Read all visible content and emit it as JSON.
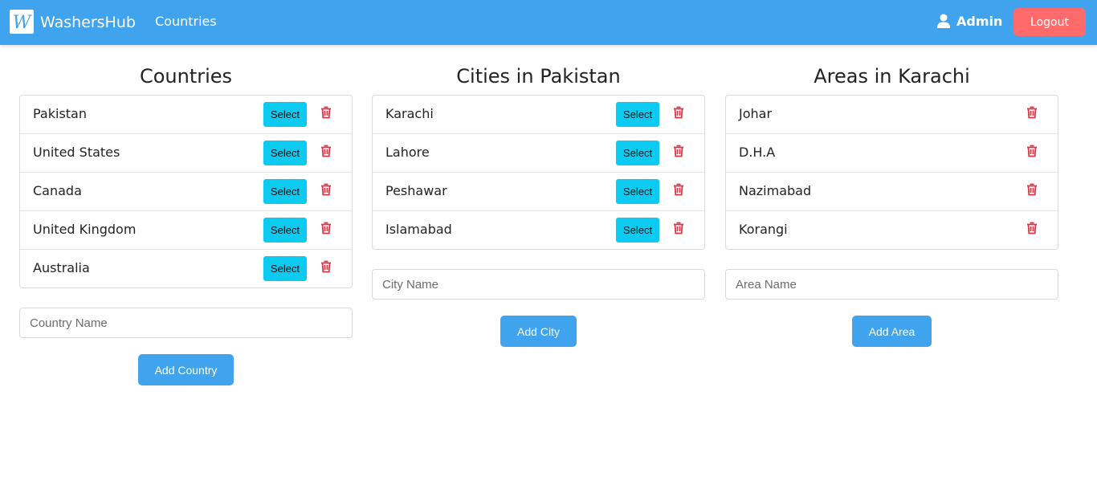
{
  "navbar": {
    "brand": "WashersHub",
    "logo_letter": "W",
    "nav_link": "Countries",
    "user_name": "Admin",
    "logout_label": "Logout",
    "bg_color": "#3fa3ee",
    "logout_color": "#ff6b6b"
  },
  "countries": {
    "title": "Countries",
    "items": [
      {
        "name": "Pakistan",
        "select_label": "Select"
      },
      {
        "name": "United States",
        "select_label": "Select"
      },
      {
        "name": "Canada",
        "select_label": "Select"
      },
      {
        "name": "United Kingdom",
        "select_label": "Select"
      },
      {
        "name": "Australia",
        "select_label": "Select"
      }
    ],
    "input_placeholder": "Country Name",
    "add_label": "Add Country"
  },
  "cities": {
    "title": "Cities in Pakistan",
    "items": [
      {
        "name": "Karachi",
        "select_label": "Select"
      },
      {
        "name": "Lahore",
        "select_label": "Select"
      },
      {
        "name": "Peshawar",
        "select_label": "Select"
      },
      {
        "name": "Islamabad",
        "select_label": "Select"
      }
    ],
    "input_placeholder": "City Name",
    "add_label": "Add City"
  },
  "areas": {
    "title": "Areas in Karachi",
    "items": [
      {
        "name": "Johar"
      },
      {
        "name": "D.H.A"
      },
      {
        "name": "Nazimabad"
      },
      {
        "name": "Korangi"
      }
    ],
    "input_placeholder": "Area Name",
    "add_label": "Add Area"
  },
  "icons": {
    "user": "user-icon",
    "delete": "trash-icon",
    "select_color": "#0dcaf0",
    "delete_color": "#dc3545"
  }
}
